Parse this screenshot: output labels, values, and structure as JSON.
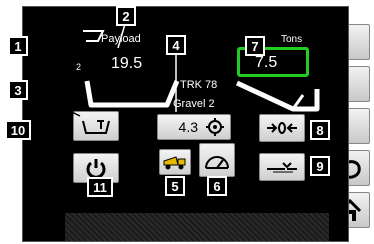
{
  "payload": {
    "label": "Payload",
    "value": "19.5",
    "index": "2"
  },
  "tons": {
    "label": "Tons",
    "value": "7.5"
  },
  "truck": {
    "id": "TRK 78",
    "material": "Gravel 2"
  },
  "target": {
    "value": "4.3"
  },
  "callouts": [
    "1",
    "2",
    "3",
    "4",
    "5",
    "6",
    "7",
    "8",
    "9",
    "10",
    "11"
  ],
  "colors": {
    "tons_highlight": "#22cc22",
    "screen_bg": "#000000"
  },
  "icons": [
    "bucket-down-icon",
    "printer-icon",
    "camera-icon",
    "power-icon",
    "truck-icon",
    "scale-icon",
    "reset-icon",
    "tare-icon",
    "undo-icon",
    "home-icon",
    "target-icon"
  ]
}
